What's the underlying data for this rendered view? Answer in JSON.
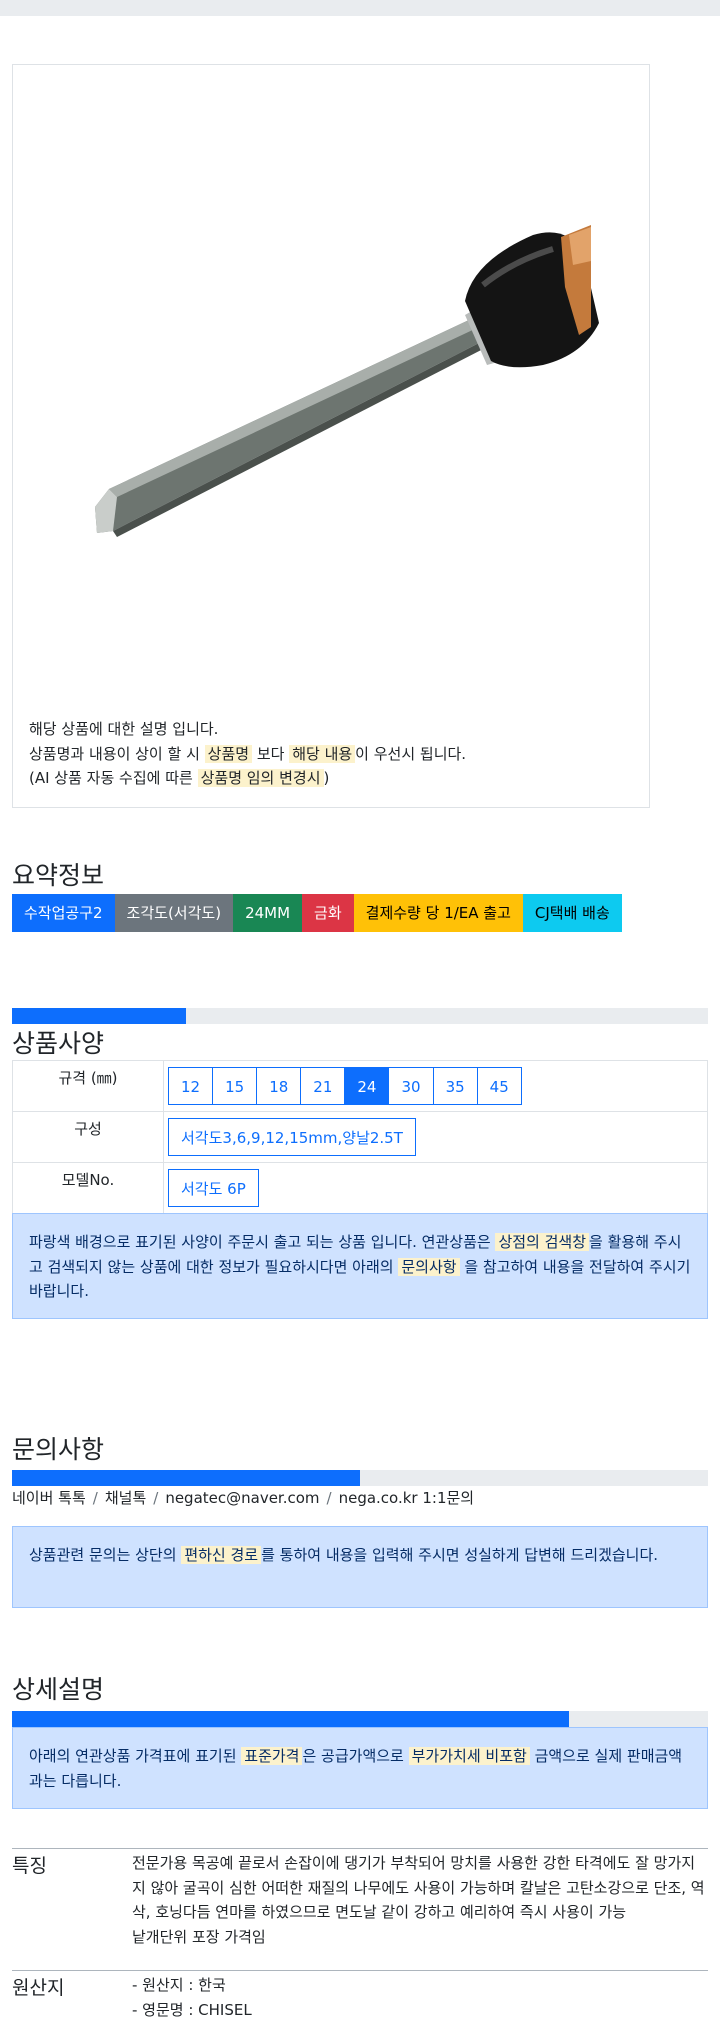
{
  "product": {
    "description": {
      "line1": "해당 상품에 대한 설명 입니다.",
      "line2_pre": "상품명과 내용이 상이 할 시 ",
      "line2_mark1": "상품명",
      "line2_mid": " 보다 ",
      "line2_mark2": "해당 내용",
      "line2_post": "이 우선시 됩니다.",
      "line3_pre": "(AI 상품 자동 수집에 따른 ",
      "line3_mark": "상품명 임의 변경시",
      "line3_post": ")"
    }
  },
  "summary": {
    "title": "요약정보",
    "badges": [
      {
        "label": "수작업공구2",
        "color": "#0d6efd",
        "text_color": "#ffffff"
      },
      {
        "label": "조각도(서각도)",
        "color": "#6c757d",
        "text_color": "#ffffff"
      },
      {
        "label": "24MM",
        "color": "#198754",
        "text_color": "#ffffff"
      },
      {
        "label": "금화",
        "color": "#dc3545",
        "text_color": "#ffffff"
      },
      {
        "label": "결제수량 당 1/EA 출고",
        "color": "#ffc107",
        "text_color": "#000000"
      },
      {
        "label": "CJ택배 배송",
        "color": "#0dcaf0",
        "text_color": "#000000"
      }
    ]
  },
  "specs": {
    "title": "상품사양",
    "progress": 0.25,
    "rows": [
      {
        "key": "규격 (㎜)",
        "options": [
          "12",
          "15",
          "18",
          "21",
          "24",
          "30",
          "35",
          "45"
        ],
        "selected": "24"
      },
      {
        "key": "구성",
        "options": [
          "서각도3,6,9,12,15mm,양날2.5T"
        ]
      },
      {
        "key": "모델No.",
        "options": [
          "서각도 6P"
        ]
      }
    ],
    "notice_pre": "파랑색 배경으로 표기된 사양이 주문시 출고 되는 상품 입니다. 연관상품은 ",
    "notice_mark1": "상점의 검색창",
    "notice_mid": "을 활용해 주시고 검색되지 않는 상품에 대한 정보가 필요하시다면 아래의 ",
    "notice_mark2": "문의사항",
    "notice_post": " 을 참고하여 내용을 전달하여 주시기 바랍니다."
  },
  "inquiry": {
    "title": "문의사항",
    "progress": 0.5,
    "channels": [
      "네이버 톡톡",
      "채널톡",
      "negatec@naver.com",
      "nega.co.kr 1:1문의"
    ],
    "notice_pre": "상품관련 문의는 상단의 ",
    "notice_mark": "편하신 경로",
    "notice_post": "를 통하여 내용을 입력해 주시면 성실하게 답변해 드리겠습니다."
  },
  "detail": {
    "title": "상세설명",
    "progress": 0.8,
    "notice_pre": "아래의 연관상품 가격표에 표기된 ",
    "notice_mark1": "표준가격",
    "notice_mid": "은 공급가액으로 ",
    "notice_mark2": "부가가치세 비포함",
    "notice_post": " 금액으로 실제 판매금액과는 다릅니다.",
    "features": {
      "key": "특징",
      "text": "전문가용 목공예 끝로서 손잡이에 댕기가 부착되어 망치를 사용한 강한 타격에도 잘 망가지지 않아 굴곡이 심한 어떠한 재질의 나무에도 사용이 가능하며 칼날은 고탄소강으로 단조, 역삭, 호닝다듬 연마를 하였으므로 면도날 같이 강하고 예리하여 즉시 사용이 가능",
      "text2": "낱개단위 포장 가격임"
    },
    "origin": {
      "key": "원산지",
      "line1": "- 원산지 : 한국",
      "line2": "- 영문명 : CHISEL"
    }
  }
}
